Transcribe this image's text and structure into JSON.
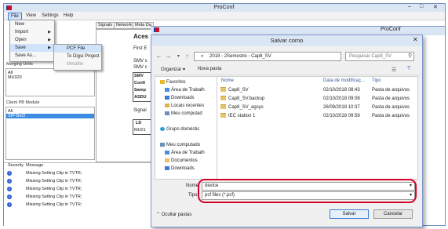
{
  "app": {
    "title": "ProConf",
    "menu": [
      "File",
      "View",
      "Settings",
      "Help"
    ]
  },
  "file_menu": {
    "items": [
      {
        "label": "New",
        "has_submenu": false
      },
      {
        "label": "Import",
        "has_submenu": true
      },
      {
        "label": "Open",
        "has_submenu": true
      },
      {
        "label": "Save",
        "has_submenu": true
      },
      {
        "label": "Save As...",
        "has_submenu": false
      }
    ],
    "save_submenu": [
      "PCF File",
      "To Digsi Project",
      "Metafile"
    ]
  },
  "left_panels": {
    "merging_units_label": "Merging Units",
    "merging_units_items": [
      "All",
      "MU320"
    ],
    "client_pb_label": "Client PB Module",
    "client_pb_items": [
      "All",
      "SIP-Bet3"
    ]
  },
  "bg_tabs": [
    "Signals",
    "Network",
    "Meta Da"
  ],
  "bg_center": {
    "heading": "Aces",
    "line1": "First E",
    "smv_lines": [
      "SMV s",
      "SMV c"
    ],
    "boxes": [
      "SMV",
      "Confi",
      "Samp",
      "ASDU"
    ],
    "signal_label": "Signal",
    "ld": [
      "LD",
      "MU01"
    ]
  },
  "log": {
    "headers": [
      "Severity",
      "Message"
    ],
    "rows": [
      "Missing Setting Clip in TVTR;",
      "Missing Setting Clip in TVTR;",
      "Missing Setting Clip in TVTR;",
      "Missing Setting Clip in TVTR;",
      "Missing Setting Clip in TVTR;"
    ]
  },
  "dialog": {
    "title": "Salvar como",
    "breadcrumb": [
      "«",
      "2018",
      "2Semestre",
      "Cap8_SV"
    ],
    "search_placeholder": "Pesquisar Cap8_SV",
    "organize_label": "Organizar",
    "new_folder_label": "Nova pasta",
    "tree": [
      {
        "label": "Favoritos",
        "type": "star"
      },
      {
        "label": "Área de Trabalh",
        "type": "desktop"
      },
      {
        "label": "Downloads",
        "type": "download"
      },
      {
        "label": "Locais recentes",
        "type": "recent"
      },
      {
        "label": "Meu computad",
        "type": "computer"
      },
      {
        "label": "Grupo doméstic",
        "type": "group"
      },
      {
        "label": "Meu computado",
        "type": "computer"
      },
      {
        "label": "Área de Trabalh",
        "type": "desktop"
      },
      {
        "label": "Documentos",
        "type": "docs"
      },
      {
        "label": "Downloads",
        "type": "download"
      }
    ],
    "columns": [
      "Nome",
      "Data de modificaç...",
      "Tipo"
    ],
    "files": [
      {
        "name": "Cap8_SV",
        "date": "02/10/2018 08:43",
        "type": "Pasta de arquivos"
      },
      {
        "name": "Cap8_SV.backup",
        "date": "02/10/2018 09:08",
        "type": "Pasta de arquivos"
      },
      {
        "name": "Cap8_SV_agsys",
        "date": "26/09/2018 10:37",
        "type": "Pasta de arquivos"
      },
      {
        "name": "IEC station 1",
        "date": "02/10/2018 09:58",
        "type": "Pasta de arquivos"
      }
    ],
    "filename_label": "Nome",
    "filename_value": "device",
    "type_label": "Tipo",
    "type_value": "pcf files (*.pcf)",
    "hide_folders_label": "Ocultar pastas",
    "save_label": "Salvar",
    "cancel_label": "Cancelar"
  },
  "colors": {
    "selection": "#3c8ce3",
    "highlight_oval": "#d4002a",
    "folder": "#e8c266"
  }
}
